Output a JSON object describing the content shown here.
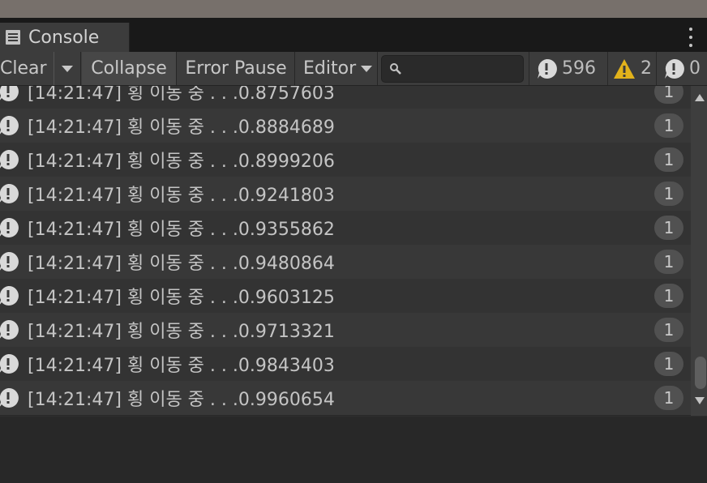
{
  "console": {
    "tab_title": "Console",
    "toolbar": {
      "clear_label": "Clear",
      "collapse_label": "Collapse",
      "error_pause_label": "Error Pause",
      "editor_label": "Editor",
      "search_placeholder": ""
    },
    "counters": {
      "log_count": "596",
      "warning_count": "2",
      "error_count": "0"
    },
    "entries": [
      {
        "message": "[14:21:47] 횡 이동 중 . . .0.8757603",
        "count": "1"
      },
      {
        "message": "[14:21:47] 횡 이동 중 . . .0.8884689",
        "count": "1"
      },
      {
        "message": "[14:21:47] 횡 이동 중 . . .0.8999206",
        "count": "1"
      },
      {
        "message": "[14:21:47] 횡 이동 중 . . .0.9241803",
        "count": "1"
      },
      {
        "message": "[14:21:47] 횡 이동 중 . . .0.9355862",
        "count": "1"
      },
      {
        "message": "[14:21:47] 횡 이동 중 . . .0.9480864",
        "count": "1"
      },
      {
        "message": "[14:21:47] 횡 이동 중 . . .0.9603125",
        "count": "1"
      },
      {
        "message": "[14:21:47] 횡 이동 중 . . .0.9713321",
        "count": "1"
      },
      {
        "message": "[14:21:47] 횡 이동 중 . . .0.9843403",
        "count": "1"
      },
      {
        "message": "[14:21:47] 횡 이동 중 . . .0.9960654",
        "count": "1"
      }
    ]
  },
  "icons": {
    "tab": "console-icon",
    "menu": "kebab-menu-icon",
    "search": "search-icon",
    "log": "info-icon",
    "warning": "warning-icon",
    "error": "error-icon"
  },
  "colors": {
    "warning_accent": "#e2b21b",
    "log_icon": "#d9d9d9"
  }
}
